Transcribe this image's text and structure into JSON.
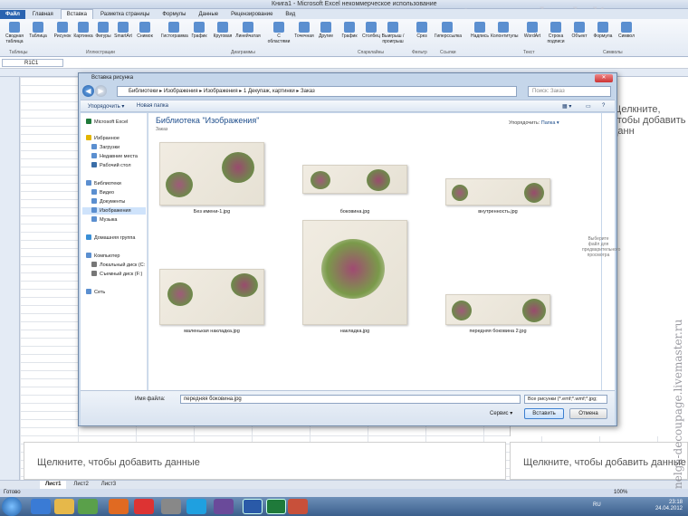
{
  "app": {
    "title": "Книга1 - Microsoft Excel некоммерческое использование"
  },
  "ribbon_tabs": [
    "Файл",
    "Главная",
    "Вставка",
    "Разметка страницы",
    "Формулы",
    "Данные",
    "Рецензирование",
    "Вид"
  ],
  "ribbon_buttons": [
    "Сводная таблица",
    "Таблица",
    "Рисунок",
    "Картинка",
    "Фигуры",
    "SmartArt",
    "Снимок",
    "Гистограмма",
    "График",
    "Круговая",
    "Линейчатая",
    "С областями",
    "Точечная",
    "Другие",
    "График",
    "Столбец",
    "Выигрыш / проигрыш",
    "Срез",
    "Гиперссылка",
    "Надпись",
    "Колонтитулы",
    "WordArt",
    "Строка подписи",
    "Объект",
    "Формула",
    "Символ"
  ],
  "ribbon_groups": [
    "Таблицы",
    "Иллюстрации",
    "Диаграммы",
    "Спарклайны",
    "Фильтр",
    "Ссылки",
    "Текст",
    "Символы"
  ],
  "namebox": "R1C1",
  "sheet": {
    "placeholder_right": "Щелкните, чтобы добавить данн",
    "placeholder_bottom_left": "Щелкните, чтобы добавить данные",
    "placeholder_bottom_right": "Щелкните, чтобы добавить данные",
    "tabs": [
      "Лист1",
      "Лист2",
      "Лист3"
    ],
    "status_left": "Готово",
    "zoom": "100%"
  },
  "dialog": {
    "title": "Вставка рисунка",
    "close_label": "✕",
    "address": "Библиотеки ▸ Изображения ▸ Изображения ▸ 1 Декупаж, картинки ▸ Заказ",
    "search_placeholder": "Поиск: Заказ",
    "toolbar": {
      "organize": "Упорядочить ▾",
      "new_folder": "Новая папка"
    },
    "nav": [
      {
        "label": "Microsoft Excel",
        "color": "#1f7a3a"
      },
      {
        "label": "Избранное",
        "color": "#e3b500"
      },
      {
        "label": "Загрузки",
        "color": "#5b8fd0"
      },
      {
        "label": "Недавние места",
        "color": "#5b8fd0"
      },
      {
        "label": "Рабочий стол",
        "color": "#3b6ea8"
      },
      {
        "label": "Библиотеки",
        "color": "#5b8fd0"
      },
      {
        "label": "Видео",
        "color": "#5b8fd0"
      },
      {
        "label": "Документы",
        "color": "#5b8fd0"
      },
      {
        "label": "Изображения",
        "color": "#5b8fd0"
      },
      {
        "label": "Музыка",
        "color": "#5b8fd0"
      },
      {
        "label": "Домашняя группа",
        "color": "#3a8fd6"
      },
      {
        "label": "Компьютер",
        "color": "#5b8fd0"
      },
      {
        "label": "Локальный диск (C:",
        "color": "#777777"
      },
      {
        "label": "Съемный диск (F:)",
        "color": "#777777"
      },
      {
        "label": "Сеть",
        "color": "#5b8fd0"
      }
    ],
    "library_title": "Библиотека \"Изображения\"",
    "library_sub": "Заказ",
    "arrange_label": "Упорядочить:",
    "arrange_value": "Папка ▾",
    "files": [
      {
        "name": "Без имени-1.jpg"
      },
      {
        "name": "боковина.jpg"
      },
      {
        "name": "внутренность.jpg"
      },
      {
        "name": "маленькая накладка.jpg"
      },
      {
        "name": "накладка.jpg"
      },
      {
        "name": "передняя боковина 2.jpg"
      }
    ],
    "preview_hint": "Выберите файл для предварительного просмотра",
    "filename_label": "Имя файла:",
    "filename_value": "передняя боковина.jpg",
    "filetype_value": "Все рисунки (*.emf;*.wmf;*.jpg;",
    "service_label": "Сервис ▾",
    "insert_label": "Вставить",
    "cancel_label": "Отмена"
  },
  "taskbar": {
    "lang": "RU",
    "time": "23:18",
    "date": "24.04.2012"
  },
  "watermarks": {
    "top": "mastera-rukodeliya.ru",
    "side": "nelga-decoupage.livemaster.ru"
  }
}
